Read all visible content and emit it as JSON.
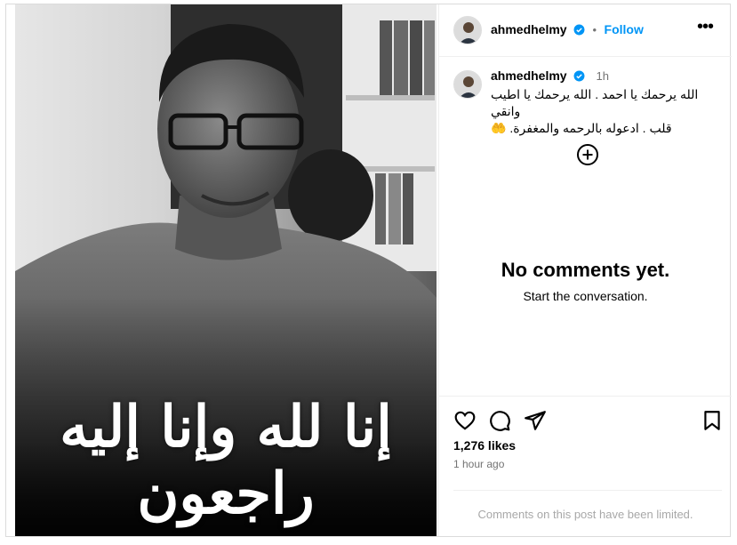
{
  "post": {
    "username": "ahmedhelmy",
    "follow_label": "Follow",
    "dot": "•",
    "more_label": "•••",
    "caption_time": "1h",
    "caption_lines": [
      "الله يرحمك يا احمد . الله يرحمك يا اطيب وانقي",
      "قلب . ادعوله بالرحمه والمغفرة. 🤲"
    ],
    "image_calligraphy": "إنا لله وإنا إليه راجعون"
  },
  "comments": {
    "empty_title": "No comments yet.",
    "empty_subtitle": "Start the conversation."
  },
  "engagement": {
    "likes": "1,276 likes",
    "posted": "1 hour ago",
    "limited_notice": "Comments on this post have been limited."
  },
  "colors": {
    "accent": "#0095f6",
    "verified": "#0095f6",
    "muted": "#737373",
    "faint": "#a8a8a8"
  },
  "icons": [
    "verified-icon",
    "more-icon",
    "add-comment-icon",
    "heart-icon",
    "comment-icon",
    "share-icon",
    "save-icon"
  ]
}
